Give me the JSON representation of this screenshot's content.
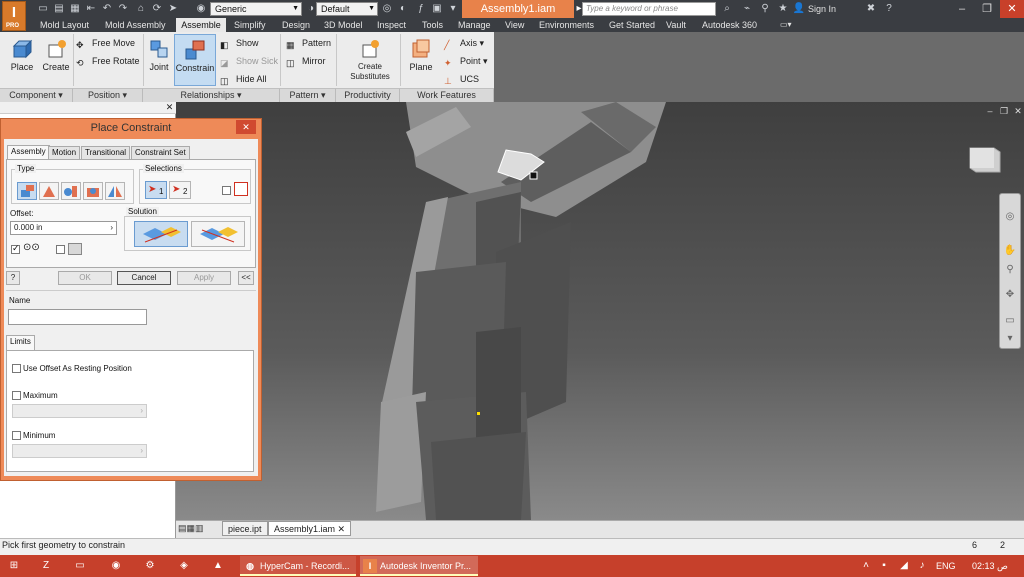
{
  "titlebar": {
    "app_logo": "I",
    "app_logo_sub": "PRO",
    "material": "Generic",
    "appearance": "Default",
    "document_title": "Assembly1.iam",
    "search_placeholder": "Type a keyword or phrase",
    "sign_in": "Sign In"
  },
  "ribbon_tabs": [
    "Mold Layout",
    "Mold Assembly",
    "Assemble",
    "Simplify",
    "Design",
    "3D Model",
    "Inspect",
    "Tools",
    "Manage",
    "View",
    "Environments",
    "Get Started",
    "Vault",
    "Autodesk 360"
  ],
  "active_tab": "Assemble",
  "ribbon": {
    "place": "Place",
    "create": "Create",
    "free_move": "Free Move",
    "free_rotate": "Free Rotate",
    "joint": "Joint",
    "constrain": "Constrain",
    "show": "Show",
    "show_sick": "Show Sick",
    "hide_all": "Hide All",
    "pattern": "Pattern",
    "mirror": "Mirror",
    "create_substitutes": "Create Substitutes",
    "plane": "Plane",
    "axis": "Axis",
    "point": "Point",
    "ucs": "UCS",
    "panels": {
      "component": "Component",
      "position": "Position",
      "relationships": "Relationships",
      "pattern": "Pattern",
      "productivity": "Productivity",
      "work_features": "Work Features"
    }
  },
  "dialog": {
    "title": "Place Constraint",
    "tabs": [
      "Assembly",
      "Motion",
      "Transitional",
      "Constraint Set"
    ],
    "type_label": "Type",
    "selections_label": "Selections",
    "sel1": "1",
    "sel2": "2",
    "offset_label": "Offset:",
    "offset_value": "0.000 in",
    "solution_label": "Solution",
    "ok": "OK",
    "cancel": "Cancel",
    "apply": "Apply",
    "expand": "<<",
    "help": "?",
    "name_label": "Name",
    "name_value": "",
    "limits_tab": "Limits",
    "use_offset": "Use Offset As Resting Position",
    "maximum": "Maximum",
    "minimum": "Minimum"
  },
  "bottom_tabs": [
    "piece.ipt",
    "Assembly1.iam"
  ],
  "status": {
    "message": "Pick first geometry to constrain",
    "count1": "6",
    "count2": "2"
  },
  "taskbar": {
    "app1": "HyperCam - Recordi...",
    "app2": "Autodesk Inventor Pr...",
    "lang": "ENG",
    "time": "02:13 ص"
  },
  "colors": {
    "accent": "#e8824a",
    "taskbar": "#c6402b",
    "viewport_top": "#3f3f3f"
  }
}
